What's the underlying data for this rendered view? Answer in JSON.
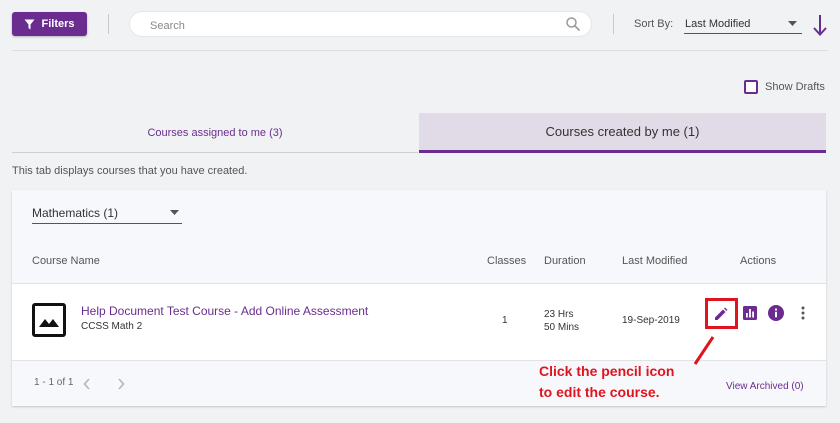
{
  "toolbar": {
    "filters_label": "Filters",
    "search_placeholder": "Search",
    "sort_by_label": "Sort By:",
    "sort_by_value": "Last Modified"
  },
  "drafts": {
    "label": "Show Drafts",
    "checked": false
  },
  "tabs": [
    {
      "label": "Courses assigned to me (3)",
      "active": false
    },
    {
      "label": "Courses created by me (1)",
      "active": true
    }
  ],
  "tab_description": "This tab displays courses that you have created.",
  "subject_filter": {
    "value": "Mathematics (1)"
  },
  "table": {
    "headers": {
      "course_name": "Course Name",
      "classes": "Classes",
      "duration": "Duration",
      "last_modified": "Last Modified",
      "actions": "Actions"
    },
    "rows": [
      {
        "title": "Help Document Test Course - Add Online Assessment",
        "subtitle": "CCSS Math 2",
        "classes": "1",
        "duration_line1": "23 Hrs",
        "duration_line2": "50 Mins",
        "last_modified": "19-Sep-2019"
      }
    ]
  },
  "pagination": {
    "text": "1 - 1 of 1"
  },
  "view_archived_label": "View Archived (0)",
  "callout": {
    "line1": "Click the pencil icon",
    "line2": "to edit the course."
  },
  "icons": {
    "filter": "filter-icon",
    "search": "search-icon",
    "sort_direction": "arrow-down-icon",
    "edit": "pencil-icon",
    "report": "bar-chart-icon",
    "info": "info-icon",
    "more": "more-vertical-icon",
    "thumbnail": "image-icon"
  },
  "colors": {
    "accent": "#6a2d8f",
    "annotation": "#e0141e",
    "background": "#f1f2f4"
  }
}
